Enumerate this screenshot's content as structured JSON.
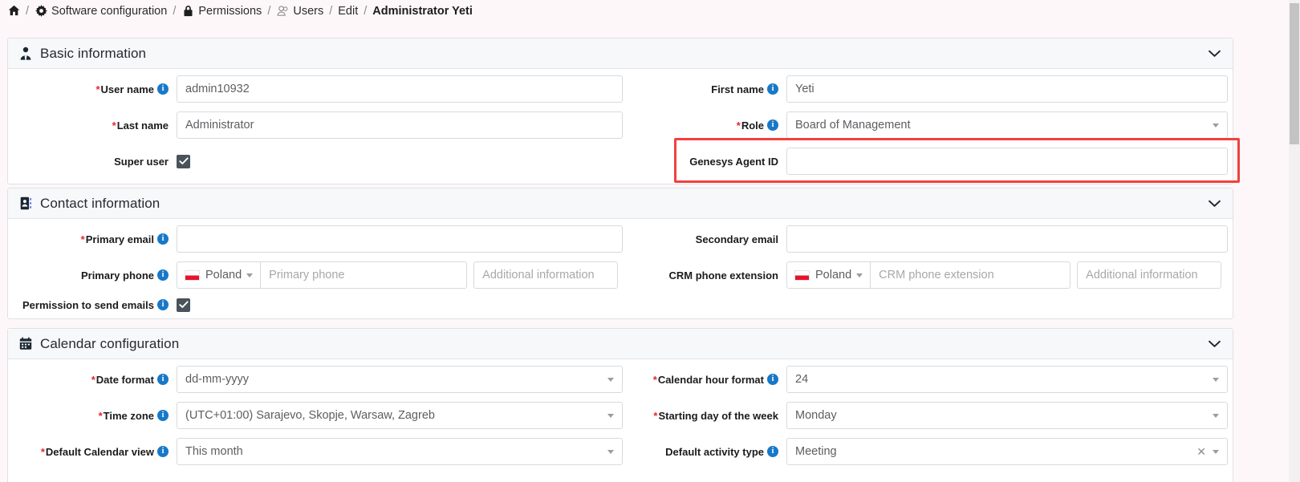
{
  "breadcrumb": {
    "items": [
      {
        "icon": "home-icon",
        "label": ""
      },
      {
        "icon": "gear-icon",
        "label": "Software configuration"
      },
      {
        "icon": "lock-icon",
        "label": "Permissions"
      },
      {
        "icon": "users-icon",
        "label": "Users"
      },
      {
        "icon": "",
        "label": "Edit"
      },
      {
        "icon": "",
        "label": "Administrator Yeti"
      }
    ],
    "separator": "/"
  },
  "sections": {
    "basic": {
      "icon": "user-tie-icon",
      "title": "Basic information",
      "collapse_icon": "chevron-down-icon",
      "fields": {
        "user_name": {
          "label": "User name",
          "required": true,
          "info": true,
          "value": "admin10932"
        },
        "first_name": {
          "label": "First name",
          "required": false,
          "info": true,
          "value": "Yeti"
        },
        "last_name": {
          "label": "Last name",
          "required": true,
          "info": false,
          "value": "Administrator"
        },
        "role": {
          "label": "Role",
          "required": true,
          "info": true,
          "value": "Board of Management"
        },
        "super_user": {
          "label": "Super user",
          "required": false,
          "info": false,
          "checked": true
        },
        "genesys_agent_id": {
          "label": "Genesys Agent ID",
          "required": false,
          "info": false,
          "value": ""
        }
      }
    },
    "contact": {
      "icon": "address-card-icon",
      "title": "Contact information",
      "collapse_icon": "chevron-down-icon",
      "fields": {
        "primary_email": {
          "label": "Primary email",
          "required": true,
          "info": true,
          "value": ""
        },
        "secondary_email": {
          "label": "Secondary email",
          "required": false,
          "info": false,
          "value": ""
        },
        "primary_phone": {
          "label": "Primary phone",
          "required": false,
          "info": true,
          "country": "Poland",
          "country_flag": "poland-flag-icon",
          "number_placeholder": "Primary phone",
          "extra_placeholder": "Additional information"
        },
        "crm_phone_extension": {
          "label": "CRM phone extension",
          "required": false,
          "info": false,
          "country": "Poland",
          "country_flag": "poland-flag-icon",
          "number_placeholder": "CRM phone extension",
          "extra_placeholder": "Additional information"
        },
        "permission_emails": {
          "label": "Permission to send emails",
          "required": false,
          "info": true,
          "checked": true
        }
      }
    },
    "calendar": {
      "icon": "calendar-icon",
      "title": "Calendar configuration",
      "collapse_icon": "chevron-down-icon",
      "fields": {
        "date_format": {
          "label": "Date format",
          "required": true,
          "info": true,
          "value": "dd-mm-yyyy"
        },
        "calendar_hour_format": {
          "label": "Calendar hour format",
          "required": true,
          "info": true,
          "value": "24"
        },
        "time_zone": {
          "label": "Time zone",
          "required": true,
          "info": true,
          "value": "(UTC+01:00) Sarajevo, Skopje, Warsaw, Zagreb"
        },
        "starting_day": {
          "label": "Starting day of the week",
          "required": true,
          "info": false,
          "value": "Monday"
        },
        "default_calendar_view": {
          "label": "Default Calendar view",
          "required": true,
          "info": true,
          "value": "This month"
        },
        "default_activity_type": {
          "label": "Default activity type",
          "required": false,
          "info": true,
          "value": "Meeting",
          "clearable": true,
          "clear_icon": "close-icon"
        }
      }
    }
  },
  "annotation": {
    "name": "red-highlight-box",
    "color": "#f0413e"
  },
  "scrollbar": {
    "name": "vertical-scrollbar"
  },
  "colors": {
    "accent": "#1878c8",
    "required": "#e8262b",
    "highlight": "#f0413e",
    "checkbox": "#49535c"
  }
}
